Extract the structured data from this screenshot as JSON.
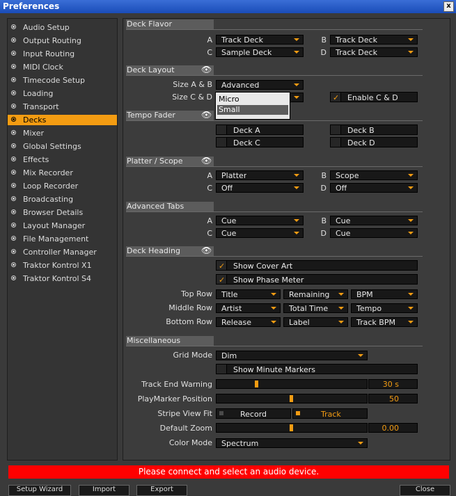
{
  "window": {
    "title": "Preferences",
    "close_glyph": "x"
  },
  "sidebar": {
    "items": [
      {
        "label": "Audio Setup"
      },
      {
        "label": "Output Routing"
      },
      {
        "label": "Input Routing"
      },
      {
        "label": "MIDI Clock"
      },
      {
        "label": "Timecode Setup"
      },
      {
        "label": "Loading"
      },
      {
        "label": "Transport"
      },
      {
        "label": "Decks",
        "selected": true
      },
      {
        "label": "Mixer"
      },
      {
        "label": "Global Settings"
      },
      {
        "label": "Effects"
      },
      {
        "label": "Mix Recorder"
      },
      {
        "label": "Loop Recorder"
      },
      {
        "label": "Broadcasting"
      },
      {
        "label": "Browser Details"
      },
      {
        "label": "Layout Manager"
      },
      {
        "label": "File Management"
      },
      {
        "label": "Controller Manager"
      },
      {
        "label": "Traktor Kontrol X1"
      },
      {
        "label": "Traktor Kontrol S4"
      }
    ]
  },
  "deck_flavor": {
    "title": "Deck Flavor",
    "a": {
      "label": "A",
      "value": "Track Deck"
    },
    "b": {
      "label": "B",
      "value": "Track Deck"
    },
    "c": {
      "label": "C",
      "value": "Sample Deck"
    },
    "d": {
      "label": "D",
      "value": "Track Deck"
    }
  },
  "deck_layout": {
    "title": "Deck Layout",
    "size_ab": {
      "label": "Size A & B",
      "value": "Advanced"
    },
    "size_cd": {
      "label": "Size C & D"
    },
    "enable_cd": {
      "label": "Enable C & D",
      "checked": true
    },
    "popup_options": [
      "Micro",
      "Small"
    ],
    "popup_selected": "Small"
  },
  "tempo_fader": {
    "title": "Tempo Fader",
    "a": {
      "label": "Deck A",
      "checked": false
    },
    "b": {
      "label": "Deck B",
      "checked": false
    },
    "c": {
      "label": "Deck C",
      "checked": false
    },
    "d": {
      "label": "Deck D",
      "checked": false
    }
  },
  "platter_scope": {
    "title": "Platter / Scope",
    "a": {
      "label": "A",
      "value": "Platter"
    },
    "b": {
      "label": "B",
      "value": "Scope"
    },
    "c": {
      "label": "C",
      "value": "Off"
    },
    "d": {
      "label": "D",
      "value": "Off"
    }
  },
  "advanced_tabs": {
    "title": "Advanced Tabs",
    "a": {
      "label": "A",
      "value": "Cue"
    },
    "b": {
      "label": "B",
      "value": "Cue"
    },
    "c": {
      "label": "C",
      "value": "Cue"
    },
    "d": {
      "label": "D",
      "value": "Cue"
    }
  },
  "deck_heading": {
    "title": "Deck Heading",
    "show_cover_art": {
      "label": "Show Cover Art",
      "checked": true
    },
    "show_phase_meter": {
      "label": "Show Phase Meter",
      "checked": true
    },
    "top_row": {
      "label": "Top Row",
      "values": [
        "Title",
        "Remaining Time",
        "BPM"
      ]
    },
    "middle_row": {
      "label": "Middle Row",
      "values": [
        "Artist",
        "Total Time",
        "Tempo"
      ]
    },
    "bottom_row": {
      "label": "Bottom Row",
      "values": [
        "Release",
        "Label",
        "Track BPM"
      ]
    }
  },
  "misc": {
    "title": "Miscellaneous",
    "grid_mode": {
      "label": "Grid Mode",
      "value": "Dim"
    },
    "show_minute_markers": {
      "label": "Show Minute Markers",
      "checked": false
    },
    "track_end_warning": {
      "label": "Track End Warning",
      "value": "30 s",
      "fraction": 0.26
    },
    "playmarker_position": {
      "label": "PlayMarker Position",
      "value": "50",
      "fraction": 0.5
    },
    "stripe_view_fit": {
      "label": "Stripe View Fit",
      "record": "Record",
      "track": "Track",
      "selected": "Track"
    },
    "default_zoom": {
      "label": "Default Zoom",
      "value": "0.00",
      "fraction": 0.5
    },
    "color_mode": {
      "label": "Color Mode",
      "value": "Spectrum"
    }
  },
  "status": {
    "message": "Please connect and select an audio device."
  },
  "footer": {
    "buttons": [
      "Setup Wizard",
      "Import",
      "Export",
      "Close"
    ]
  },
  "colors": {
    "accent": "#f39c12",
    "warning": "#ff0000",
    "title_bar": "#2a5cc8"
  },
  "icons": {
    "eye": "eye-icon",
    "arrow": "chevron-down-icon"
  }
}
